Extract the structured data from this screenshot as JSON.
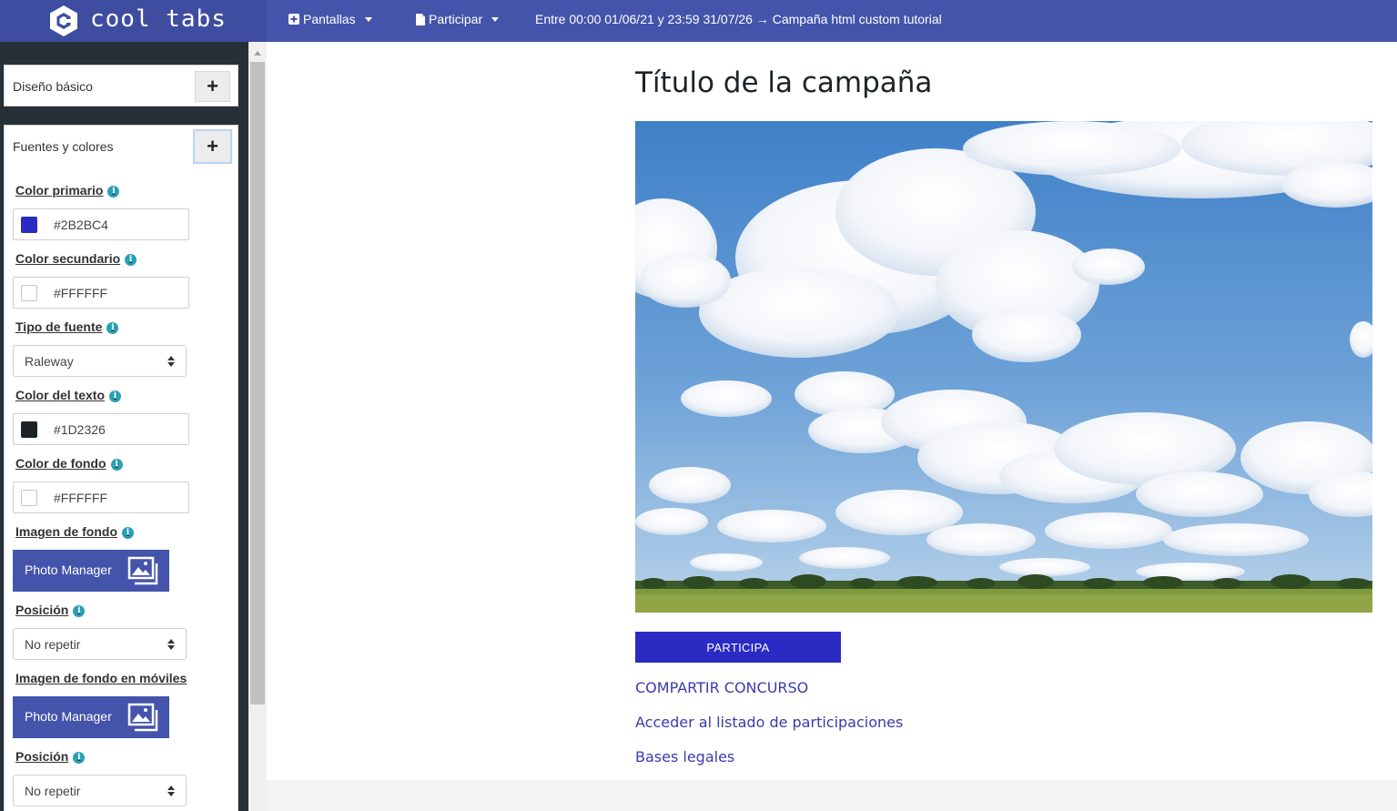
{
  "app": {
    "logo_text": "cool tabs"
  },
  "nav": {
    "pantallas": "Pantallas",
    "participar": "Participar",
    "info": "Entre 00:00 01/06/21 y 23:59 31/07/26 → Campaña html custom tutorial"
  },
  "sidebar": {
    "panel_basic": "Diseño básico",
    "panel_fonts": "Fuentes y colores",
    "plus": "+",
    "fields": {
      "primary_label": "Color primario",
      "primary_value": "#2B2BC4",
      "secondary_label": "Color secundario",
      "secondary_value": "#FFFFFF",
      "font_label": "Tipo de fuente",
      "font_value": "Raleway",
      "text_color_label": "Color del texto",
      "text_color_value": "#1D2326",
      "bg_color_label": "Color de fondo",
      "bg_color_value": "#FFFFFF",
      "bg_image_label": "Imagen de fondo",
      "photo_manager": "Photo Manager",
      "position_label": "Posición",
      "position_value": "No repetir",
      "bg_mobile_label": "Imagen de fondo en móviles",
      "photo_manager_2": "Photo Manager",
      "position_label_2": "Posición",
      "position_value_2": "No repetir"
    },
    "info_glyph": "i"
  },
  "colors": {
    "primary": "#2B2BC4",
    "secondary": "#FFFFFF",
    "text": "#1D2326",
    "background": "#FFFFFF",
    "topbar": "#4454AB"
  },
  "main": {
    "title": "Título de la campaña",
    "cta": "PARTICIPA",
    "links": [
      "COMPARTIR CONCURSO",
      "Acceder al listado de participaciones",
      "Bases legales"
    ]
  },
  "icons": {
    "logo": "cube-logo-icon",
    "pantallas": "plus-square-icon",
    "participar": "document-icon",
    "photo": "image-gallery-icon",
    "info": "info-circle-icon"
  }
}
